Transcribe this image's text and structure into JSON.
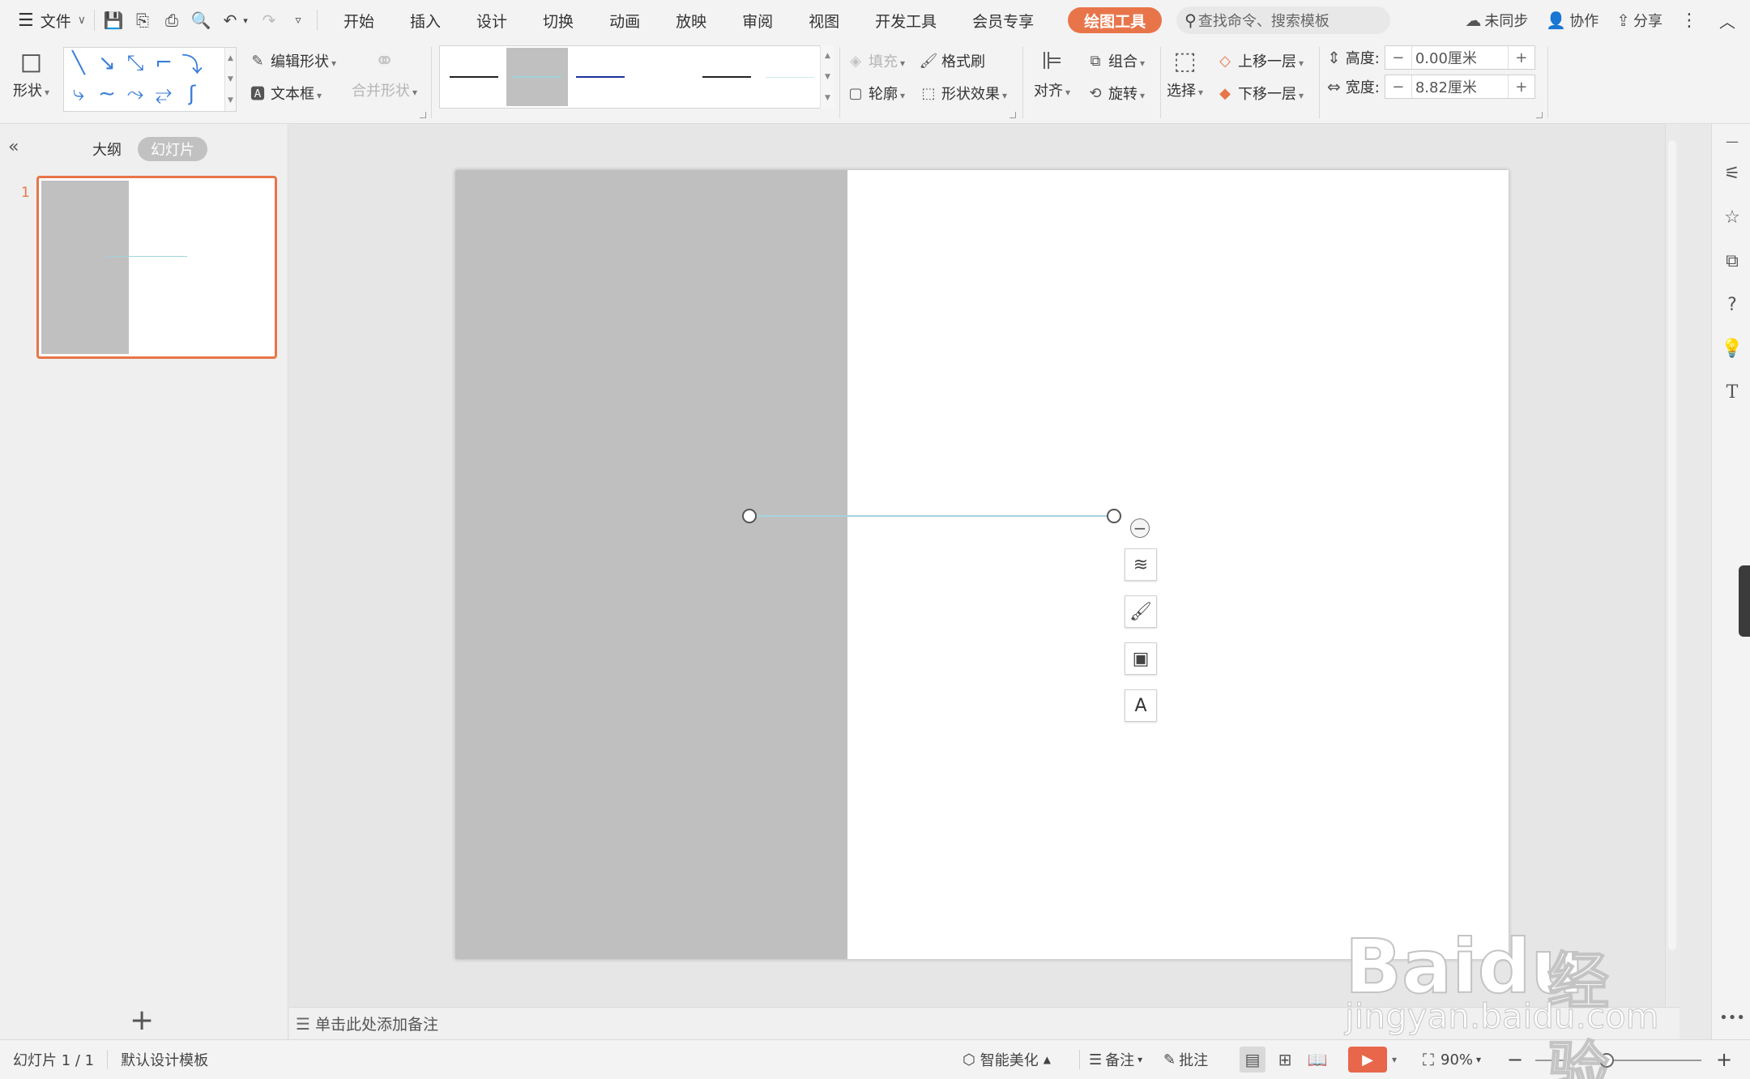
{
  "menubar": {
    "file_label": "文件",
    "tabs": [
      "开始",
      "插入",
      "设计",
      "切换",
      "动画",
      "放映",
      "审阅",
      "视图",
      "开发工具",
      "会员专享"
    ],
    "active_tab": "绘图工具",
    "search_placeholder": "查找命令、搜索模板",
    "sync_label": "未同步",
    "collab_label": "协作",
    "share_label": "分享"
  },
  "ribbon": {
    "shape_label": "形状",
    "edit_shape_label": "编辑形状",
    "textbox_label": "文本框",
    "merge_shape_label": "合并形状",
    "fill_label": "填充",
    "format_brush_label": "格式刷",
    "outline_label": "轮廓",
    "shape_effect_label": "形状效果",
    "align_label": "对齐",
    "group_label": "组合",
    "rotate_label": "旋转",
    "select_label": "选择",
    "bring_forward_label": "上移一层",
    "send_backward_label": "下移一层",
    "height_label": "高度:",
    "height_value": "0.00厘米",
    "width_label": "宽度:",
    "width_value": "8.82厘米",
    "line_styles": [
      {
        "color": "#222222",
        "selected": false
      },
      {
        "color": "#9fd3db",
        "selected": true
      },
      {
        "color": "#1f2f9f",
        "selected": false
      },
      {
        "color": "#ffffff",
        "selected": false
      },
      {
        "color": "#222222",
        "selected": false
      },
      {
        "color": "#cfe8ec",
        "selected": false
      }
    ]
  },
  "leftpanel": {
    "outline_tab": "大纲",
    "slides_tab": "幻灯片",
    "slide_number": "1"
  },
  "canvas": {
    "notes_placeholder": "单击此处添加备注"
  },
  "statusbar": {
    "slide_info": "幻灯片 1 / 1",
    "template": "默认设计模板",
    "smart_beautify": "智能美化",
    "notes_label": "备注",
    "comments_label": "批注",
    "zoom": "90%"
  },
  "watermark": {
    "brand": "Baidu",
    "brand_cn": "经验",
    "url": "jingyan.baidu.com"
  },
  "colors": {
    "accent": "#e8754a",
    "slide_gray": "#bfbfbf",
    "connector": "#a6d3dd"
  }
}
